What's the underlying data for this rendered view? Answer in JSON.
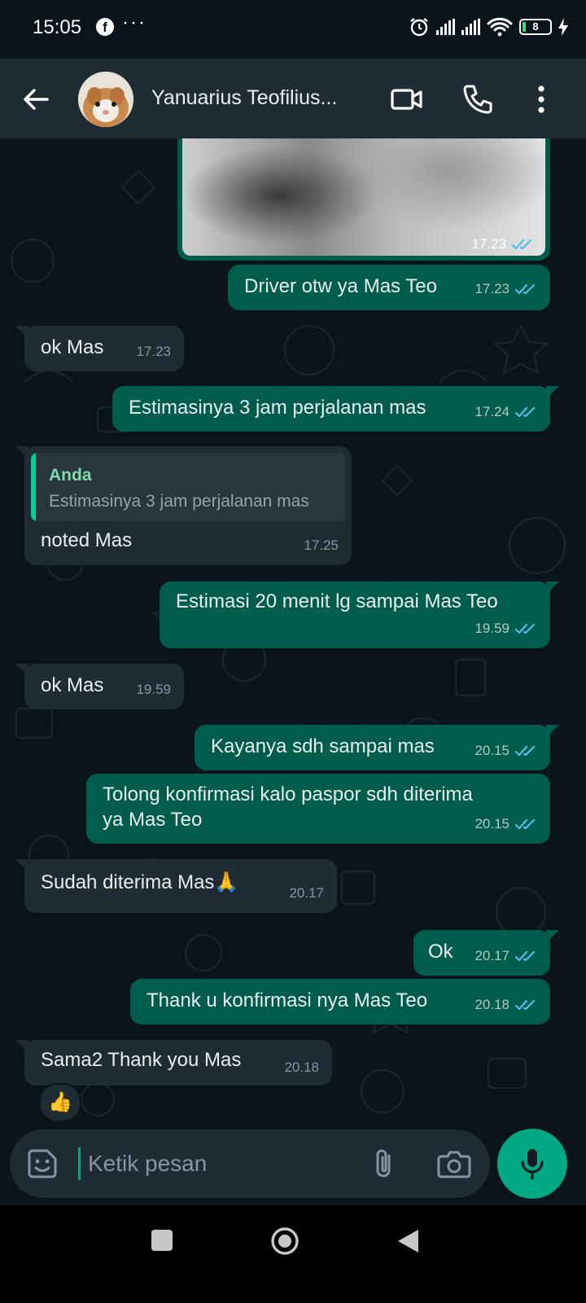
{
  "status_bar": {
    "time": "15:05",
    "notification_icons": [
      "facebook-icon",
      "more-dots"
    ],
    "system_icons": [
      "alarm-icon",
      "signal-icon",
      "signal-icon",
      "wifi-icon",
      "battery-icon",
      "charging-icon"
    ],
    "battery_level": "8"
  },
  "header": {
    "contact_name": "Yanuarius Teofilius...",
    "actions": [
      "back-arrow-icon",
      "video-call-icon",
      "voice-call-icon",
      "more-options-icon"
    ]
  },
  "messages": [
    {
      "id": "m0",
      "direction": "out",
      "type": "image",
      "time": "17.23",
      "status": "read"
    },
    {
      "id": "m1",
      "direction": "out",
      "text": "Driver otw ya Mas Teo",
      "time": "17.23",
      "status": "read"
    },
    {
      "id": "m2",
      "direction": "in",
      "text": "ok Mas",
      "time": "17.23"
    },
    {
      "id": "m3",
      "direction": "out",
      "text": "Estimasinya 3 jam perjalanan mas",
      "time": "17.24",
      "status": "read"
    },
    {
      "id": "m4",
      "direction": "in",
      "quote_author": "Anda",
      "quote_text": "Estimasinya 3 jam perjalanan mas",
      "text": "noted Mas",
      "time": "17.25"
    },
    {
      "id": "m5",
      "direction": "out",
      "text": "Estimasi 20 menit lg sampai Mas Teo",
      "time": "19.59",
      "status": "read"
    },
    {
      "id": "m6",
      "direction": "in",
      "text": "ok Mas",
      "time": "19.59"
    },
    {
      "id": "m7",
      "direction": "out",
      "text": "Kayanya sdh sampai mas",
      "time": "20.15",
      "status": "read"
    },
    {
      "id": "m8",
      "direction": "out",
      "text_line1": "Tolong konfirmasi kalo paspor sdh diterima",
      "text_line2": "ya Mas Teo",
      "time": "20.15",
      "status": "read"
    },
    {
      "id": "m9",
      "direction": "in",
      "text": "Sudah diterima Mas🙏",
      "time": "20.17"
    },
    {
      "id": "m10",
      "direction": "out",
      "text": "Ok",
      "time": "20.17",
      "status": "read"
    },
    {
      "id": "m11",
      "direction": "out",
      "text": "Thank u konfirmasi nya Mas Teo",
      "time": "20.18",
      "status": "read"
    },
    {
      "id": "m12",
      "direction": "in",
      "text": "Sama2 Thank you Mas",
      "time": "20.18",
      "reaction": "👍"
    }
  ],
  "composer": {
    "placeholder": "Ketik pesan",
    "icons": [
      "sticker-icon",
      "attach-icon",
      "camera-icon",
      "mic-icon"
    ]
  },
  "nav_bar": [
    "recents-button",
    "home-button",
    "back-button"
  ],
  "colors": {
    "background": "#0b141a",
    "header": "#1f2c34",
    "outgoing_bubble": "#005c4b",
    "incoming_bubble": "#1f2c34",
    "accent": "#00a884",
    "read_ticks": "#53bdeb",
    "quote_author": "#80d9a8"
  }
}
